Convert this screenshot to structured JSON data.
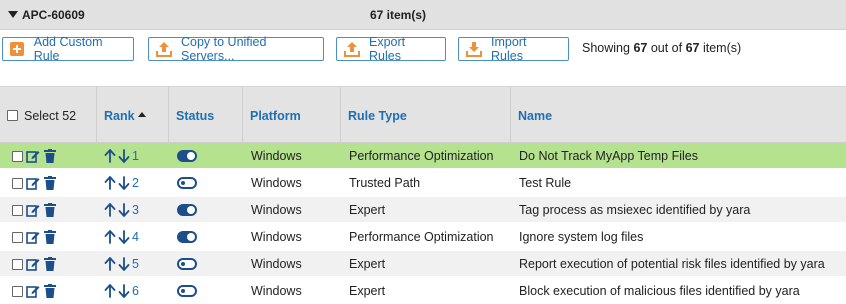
{
  "group": {
    "name": "APC-60609",
    "count": "67 item(s)"
  },
  "toolbar": {
    "add_label": "Add Custom Rule",
    "copy_label": "Copy to Unified Servers...",
    "export_label": "Export Rules",
    "import_label": "Import Rules",
    "showing_prefix": "Showing ",
    "showing_count": "67",
    "showing_mid": " out of ",
    "showing_total": "67",
    "showing_suffix": " item(s)"
  },
  "columns": {
    "select": "Select 52",
    "rank": "Rank",
    "status": "Status",
    "platform": "Platform",
    "rule_type": "Rule Type",
    "name": "Name"
  },
  "rows": [
    {
      "rank": "1",
      "status": "on",
      "platform": "Windows",
      "rule_type": "Performance Optimization",
      "name": "Do Not Track MyApp Temp Files"
    },
    {
      "rank": "2",
      "status": "off",
      "platform": "Windows",
      "rule_type": "Trusted Path",
      "name": "Test Rule"
    },
    {
      "rank": "3",
      "status": "on",
      "platform": "Windows",
      "rule_type": "Expert",
      "name": "Tag process as msiexec identified by yara"
    },
    {
      "rank": "4",
      "status": "on",
      "platform": "Windows",
      "rule_type": "Performance Optimization",
      "name": "Ignore system log files"
    },
    {
      "rank": "5",
      "status": "off",
      "platform": "Windows",
      "rule_type": "Expert",
      "name": "Report execution of potential risk files identified by yara"
    },
    {
      "rank": "6",
      "status": "off",
      "platform": "Windows",
      "rule_type": "Expert",
      "name": "Block execution of malicious files identified by yara"
    }
  ],
  "colors": {
    "accent": "#1f6fb2",
    "selected_row": "#b5e28f",
    "toggle": "#1c4f8a",
    "icon_orange": "#f0913a"
  }
}
